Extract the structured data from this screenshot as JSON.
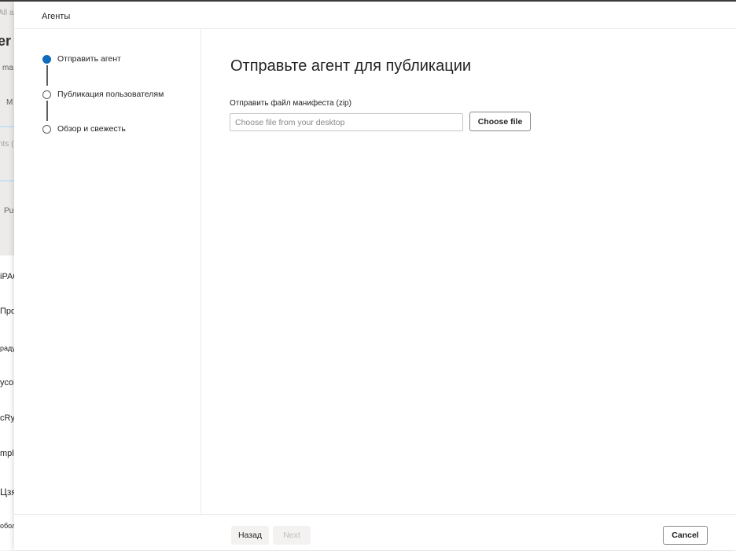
{
  "background": {
    "fragments": [
      "All a",
      "er",
      "ma",
      "M",
      "nts (",
      "Pub"
    ],
    "list_items": [
      "iPAQ",
      "Проверка",
      "радужной",
      "ycor",
      "cRys",
      "mpla",
      "Цзянь (Jian)",
      "оболочки Trill"
    ]
  },
  "panel": {
    "title": "Агенты",
    "steps": [
      {
        "label": "Отправить агент",
        "state": "active"
      },
      {
        "label": "Публикация пользователям",
        "state": "pending"
      },
      {
        "label": "Обзор и свежесть",
        "state": "pending"
      }
    ],
    "heading": "Отправьте агент для публикации",
    "manifest": {
      "label": "Отправить файл манифеста (zip)",
      "placeholder": "Choose file from your desktop",
      "button": "Choose file"
    },
    "footer": {
      "back": "Назад",
      "next": "Next",
      "cancel": "Cancel"
    }
  },
  "colors": {
    "accent": "#0f6cbd"
  }
}
